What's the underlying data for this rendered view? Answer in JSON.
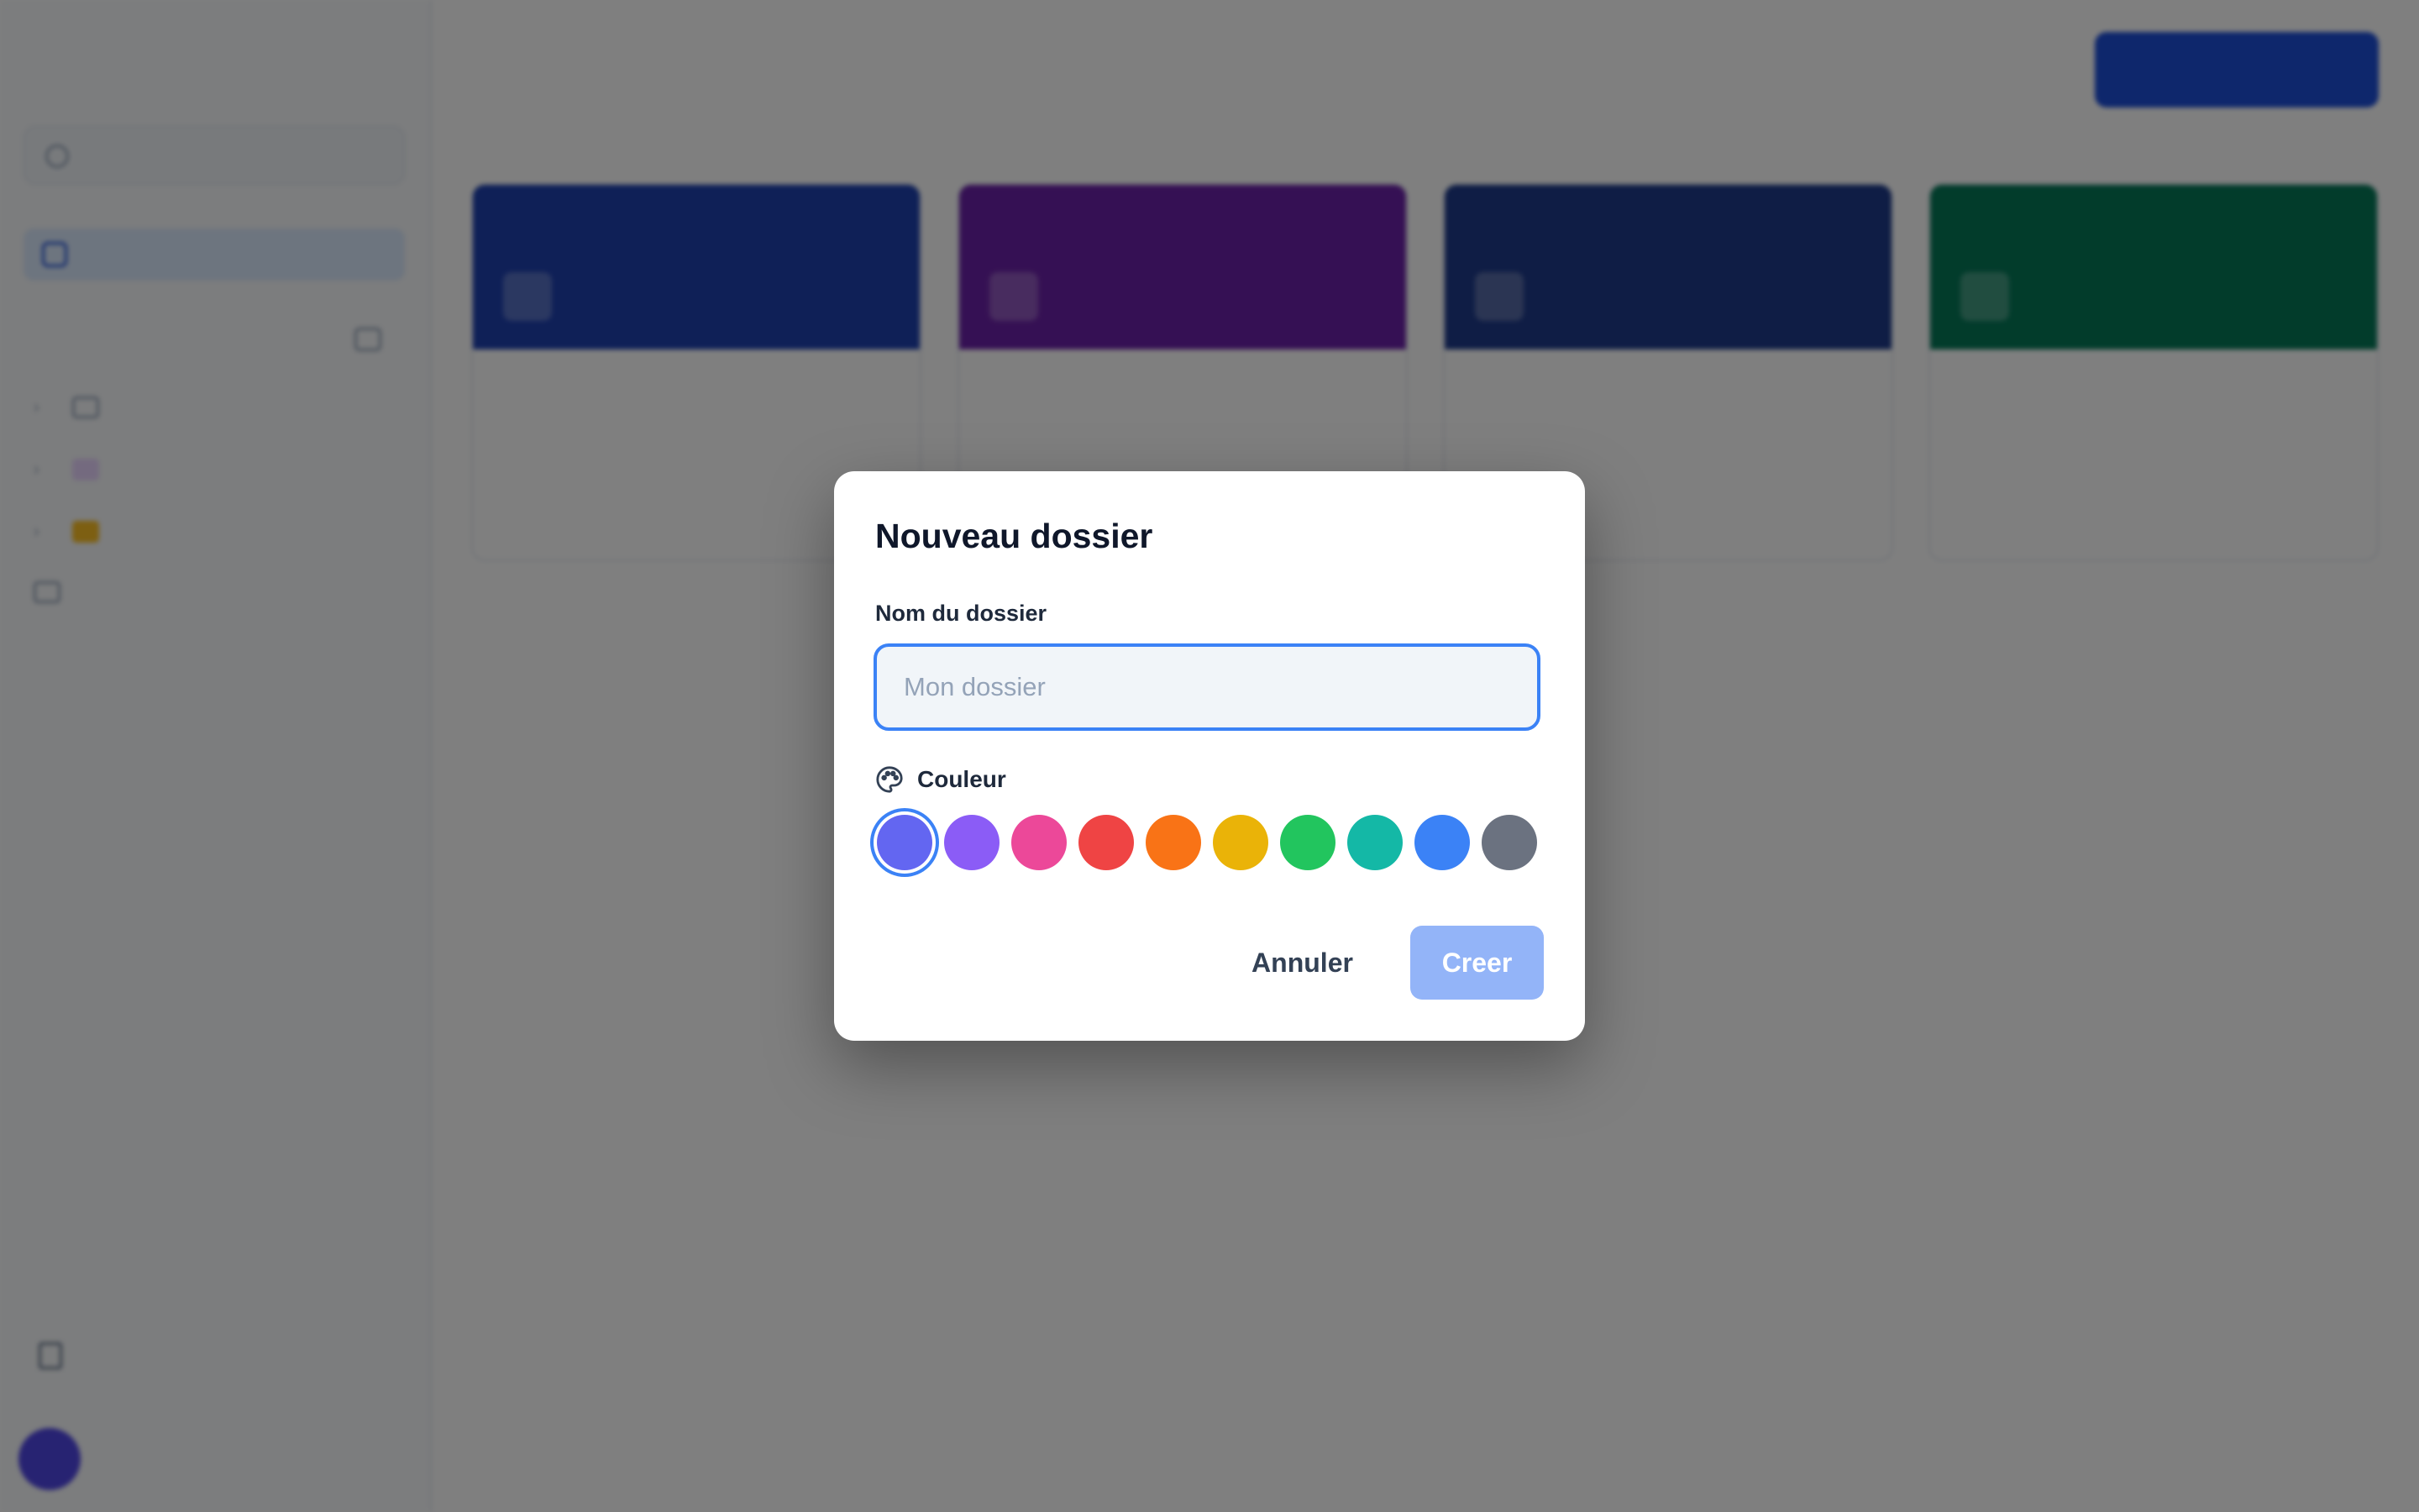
{
  "modal": {
    "title": "Nouveau dossier",
    "name_label": "Nom du dossier",
    "name_placeholder": "Mon dossier",
    "name_value": "",
    "color_label": "Couleur",
    "colors": [
      "#6366f1",
      "#8b5cf6",
      "#ec4899",
      "#ef4444",
      "#f97316",
      "#eab308",
      "#22c55e",
      "#14b8a6",
      "#3b82f6",
      "#6b7280"
    ],
    "selected_color_index": 0,
    "cancel_label": "Annuler",
    "create_label": "Creer"
  }
}
